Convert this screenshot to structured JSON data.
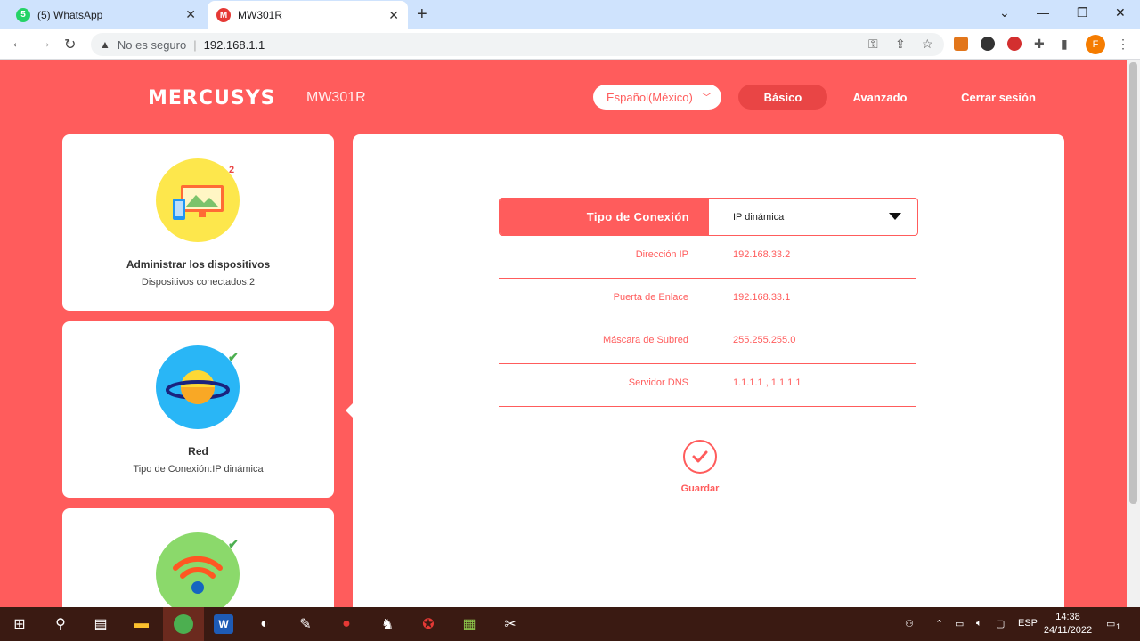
{
  "browser": {
    "tabs": [
      {
        "title": "(5) WhatsApp",
        "favicon": "whatsapp-icon",
        "active": false
      },
      {
        "title": "MW301R",
        "favicon": "mercusys-icon",
        "active": true
      }
    ],
    "address": {
      "security_text": "No es seguro",
      "url": "192.168.1.1"
    },
    "profile_initial": "F"
  },
  "router": {
    "brand": "MERCUSYS",
    "model": "MW301R",
    "language": "Español(México)",
    "nav": {
      "basic": "Básico",
      "advanced": "Avanzado",
      "logout": "Cerrar sesión"
    }
  },
  "cards": [
    {
      "title": "Administrar los dispositivos",
      "subtitle": "Dispositivos conectados:2",
      "badge": "2",
      "icon": "devices-icon"
    },
    {
      "title": "Red",
      "subtitle": "Tipo de Conexión:IP dinámica",
      "icon": "planet-icon",
      "status": "check"
    },
    {
      "title": "",
      "subtitle": "",
      "icon": "wifi-icon",
      "status": "check"
    }
  ],
  "network": {
    "conn_type_label": "Tipo de Conexión",
    "conn_type_value": "IP dinámica",
    "rows": [
      {
        "label": "Dirección IP",
        "value": "192.168.33.2"
      },
      {
        "label": "Puerta de Enlace",
        "value": "192.168.33.1"
      },
      {
        "label": "Máscara de Subred",
        "value": "255.255.255.0"
      },
      {
        "label": "Servidor DNS",
        "value": "1.1.1.1 , 1.1.1.1"
      }
    ],
    "save_label": "Guardar"
  },
  "taskbar": {
    "language": "ESP",
    "time": "14:38",
    "date": "24/11/2022",
    "notifications": "1"
  },
  "colors": {
    "accent": "#ff5c5c",
    "accent_dark": "#e94545"
  }
}
